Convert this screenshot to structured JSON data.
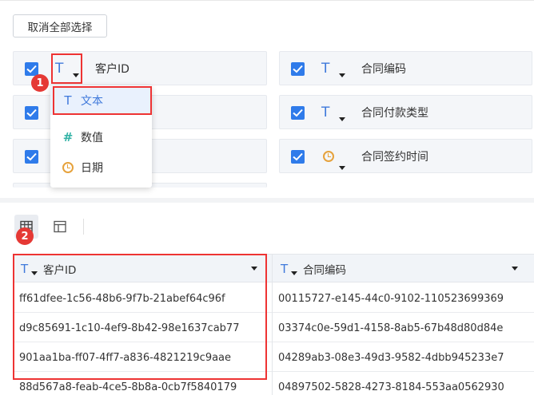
{
  "toolbar": {
    "deselect_all_label": "取消全部选择"
  },
  "fields": [
    {
      "label": "客户ID",
      "type_glyph": "T"
    },
    {
      "label": "合同编码",
      "type_glyph": "T"
    },
    {
      "label": "",
      "type_glyph": "T"
    },
    {
      "label": "合同付款类型",
      "type_glyph": "T"
    },
    {
      "label": "",
      "type_glyph": "T"
    },
    {
      "label": "合同签约时间",
      "type_glyph": "clock"
    }
  ],
  "type_dropdown": {
    "items": [
      {
        "label": "文本",
        "icon": "text-type-icon",
        "glyph": "T",
        "selected": true
      },
      {
        "label": "数值",
        "icon": "number-type-icon",
        "glyph": "#",
        "selected": false
      },
      {
        "label": "日期",
        "icon": "date-type-icon",
        "glyph": "clock",
        "selected": false
      }
    ]
  },
  "annotations": {
    "badge1": "1",
    "badge2": "2"
  },
  "table": {
    "columns": [
      {
        "name": "客户ID",
        "type_glyph": "T"
      },
      {
        "name": "合同编码",
        "type_glyph": "T"
      }
    ],
    "rows": [
      [
        "ff61dfee-1c56-48b6-9f7b-21abef64c96f",
        "00115727-e145-44c0-9102-110523699369"
      ],
      [
        "d9c85691-1c10-4ef9-8b42-98e1637cab77",
        "03374c0e-59d1-4158-8ab5-67b48d80d84e"
      ],
      [
        "901aa1ba-ff07-4ff7-a836-4821219c9aae",
        "04289ab3-08e3-49d3-9582-4dbb945233e7"
      ],
      [
        "88d567a8-feab-4ce5-8b8a-0cb7f5840179",
        "04897502-5828-4273-8184-553aa0562930"
      ]
    ]
  },
  "colors": {
    "accent": "#2f7bea",
    "annotation_red": "#e53935",
    "date_icon": "#e6a23c",
    "number_icon": "#33b3a6"
  }
}
